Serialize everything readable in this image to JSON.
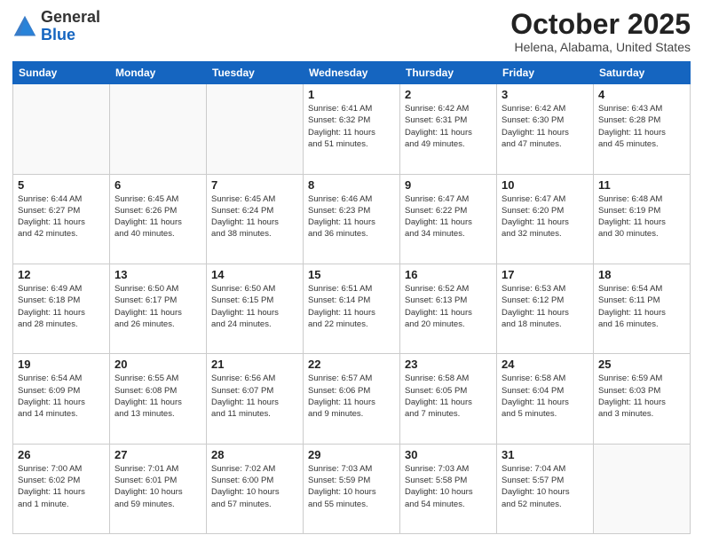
{
  "header": {
    "logo_general": "General",
    "logo_blue": "Blue",
    "month": "October 2025",
    "location": "Helena, Alabama, United States"
  },
  "days_of_week": [
    "Sunday",
    "Monday",
    "Tuesday",
    "Wednesday",
    "Thursday",
    "Friday",
    "Saturday"
  ],
  "weeks": [
    [
      {
        "day": "",
        "info": ""
      },
      {
        "day": "",
        "info": ""
      },
      {
        "day": "",
        "info": ""
      },
      {
        "day": "1",
        "info": "Sunrise: 6:41 AM\nSunset: 6:32 PM\nDaylight: 11 hours\nand 51 minutes."
      },
      {
        "day": "2",
        "info": "Sunrise: 6:42 AM\nSunset: 6:31 PM\nDaylight: 11 hours\nand 49 minutes."
      },
      {
        "day": "3",
        "info": "Sunrise: 6:42 AM\nSunset: 6:30 PM\nDaylight: 11 hours\nand 47 minutes."
      },
      {
        "day": "4",
        "info": "Sunrise: 6:43 AM\nSunset: 6:28 PM\nDaylight: 11 hours\nand 45 minutes."
      }
    ],
    [
      {
        "day": "5",
        "info": "Sunrise: 6:44 AM\nSunset: 6:27 PM\nDaylight: 11 hours\nand 42 minutes."
      },
      {
        "day": "6",
        "info": "Sunrise: 6:45 AM\nSunset: 6:26 PM\nDaylight: 11 hours\nand 40 minutes."
      },
      {
        "day": "7",
        "info": "Sunrise: 6:45 AM\nSunset: 6:24 PM\nDaylight: 11 hours\nand 38 minutes."
      },
      {
        "day": "8",
        "info": "Sunrise: 6:46 AM\nSunset: 6:23 PM\nDaylight: 11 hours\nand 36 minutes."
      },
      {
        "day": "9",
        "info": "Sunrise: 6:47 AM\nSunset: 6:22 PM\nDaylight: 11 hours\nand 34 minutes."
      },
      {
        "day": "10",
        "info": "Sunrise: 6:47 AM\nSunset: 6:20 PM\nDaylight: 11 hours\nand 32 minutes."
      },
      {
        "day": "11",
        "info": "Sunrise: 6:48 AM\nSunset: 6:19 PM\nDaylight: 11 hours\nand 30 minutes."
      }
    ],
    [
      {
        "day": "12",
        "info": "Sunrise: 6:49 AM\nSunset: 6:18 PM\nDaylight: 11 hours\nand 28 minutes."
      },
      {
        "day": "13",
        "info": "Sunrise: 6:50 AM\nSunset: 6:17 PM\nDaylight: 11 hours\nand 26 minutes."
      },
      {
        "day": "14",
        "info": "Sunrise: 6:50 AM\nSunset: 6:15 PM\nDaylight: 11 hours\nand 24 minutes."
      },
      {
        "day": "15",
        "info": "Sunrise: 6:51 AM\nSunset: 6:14 PM\nDaylight: 11 hours\nand 22 minutes."
      },
      {
        "day": "16",
        "info": "Sunrise: 6:52 AM\nSunset: 6:13 PM\nDaylight: 11 hours\nand 20 minutes."
      },
      {
        "day": "17",
        "info": "Sunrise: 6:53 AM\nSunset: 6:12 PM\nDaylight: 11 hours\nand 18 minutes."
      },
      {
        "day": "18",
        "info": "Sunrise: 6:54 AM\nSunset: 6:11 PM\nDaylight: 11 hours\nand 16 minutes."
      }
    ],
    [
      {
        "day": "19",
        "info": "Sunrise: 6:54 AM\nSunset: 6:09 PM\nDaylight: 11 hours\nand 14 minutes."
      },
      {
        "day": "20",
        "info": "Sunrise: 6:55 AM\nSunset: 6:08 PM\nDaylight: 11 hours\nand 13 minutes."
      },
      {
        "day": "21",
        "info": "Sunrise: 6:56 AM\nSunset: 6:07 PM\nDaylight: 11 hours\nand 11 minutes."
      },
      {
        "day": "22",
        "info": "Sunrise: 6:57 AM\nSunset: 6:06 PM\nDaylight: 11 hours\nand 9 minutes."
      },
      {
        "day": "23",
        "info": "Sunrise: 6:58 AM\nSunset: 6:05 PM\nDaylight: 11 hours\nand 7 minutes."
      },
      {
        "day": "24",
        "info": "Sunrise: 6:58 AM\nSunset: 6:04 PM\nDaylight: 11 hours\nand 5 minutes."
      },
      {
        "day": "25",
        "info": "Sunrise: 6:59 AM\nSunset: 6:03 PM\nDaylight: 11 hours\nand 3 minutes."
      }
    ],
    [
      {
        "day": "26",
        "info": "Sunrise: 7:00 AM\nSunset: 6:02 PM\nDaylight: 11 hours\nand 1 minute."
      },
      {
        "day": "27",
        "info": "Sunrise: 7:01 AM\nSunset: 6:01 PM\nDaylight: 10 hours\nand 59 minutes."
      },
      {
        "day": "28",
        "info": "Sunrise: 7:02 AM\nSunset: 6:00 PM\nDaylight: 10 hours\nand 57 minutes."
      },
      {
        "day": "29",
        "info": "Sunrise: 7:03 AM\nSunset: 5:59 PM\nDaylight: 10 hours\nand 55 minutes."
      },
      {
        "day": "30",
        "info": "Sunrise: 7:03 AM\nSunset: 5:58 PM\nDaylight: 10 hours\nand 54 minutes."
      },
      {
        "day": "31",
        "info": "Sunrise: 7:04 AM\nSunset: 5:57 PM\nDaylight: 10 hours\nand 52 minutes."
      },
      {
        "day": "",
        "info": ""
      }
    ]
  ]
}
